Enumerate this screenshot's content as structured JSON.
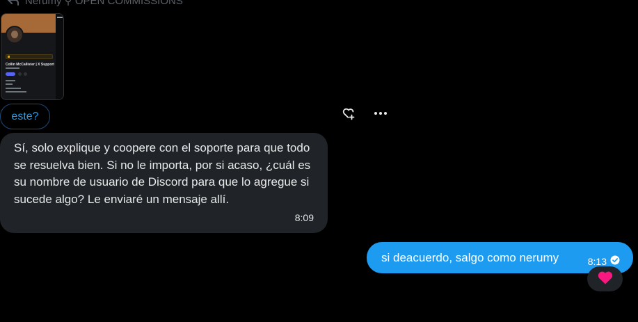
{
  "reply_header": {
    "icon": "reply-arrow-icon",
    "text": "Nerumy ⚲ OPEN COMMISSIONS"
  },
  "attachment": {
    "profile_name": "Collin McCallister | X Support"
  },
  "messages": {
    "reply_pill": "este?",
    "incoming": {
      "text": "Sí, solo explique y coopere con el soporte para que todo se resuelva bien. Si no le importa, por si acaso, ¿cuál es su nombre de usuario de Discord para que lo agregue si sucede algo? Le enviaré un mensaje allí.",
      "time": "8:09"
    },
    "outgoing": {
      "text": "si deacuerdo, salgo como nerumy",
      "time": "8:13",
      "status_icon": "read-check-icon"
    },
    "reaction": "heart-icon"
  },
  "actions": {
    "react_icon": "heart-plus-icon",
    "more_icon": "more-dots-icon"
  },
  "colors": {
    "background": "#000000",
    "incoming_bubble": "#202327",
    "outgoing_bubble": "#1d9bf0",
    "accent": "#1d9bf0",
    "heart": "#f91880"
  }
}
